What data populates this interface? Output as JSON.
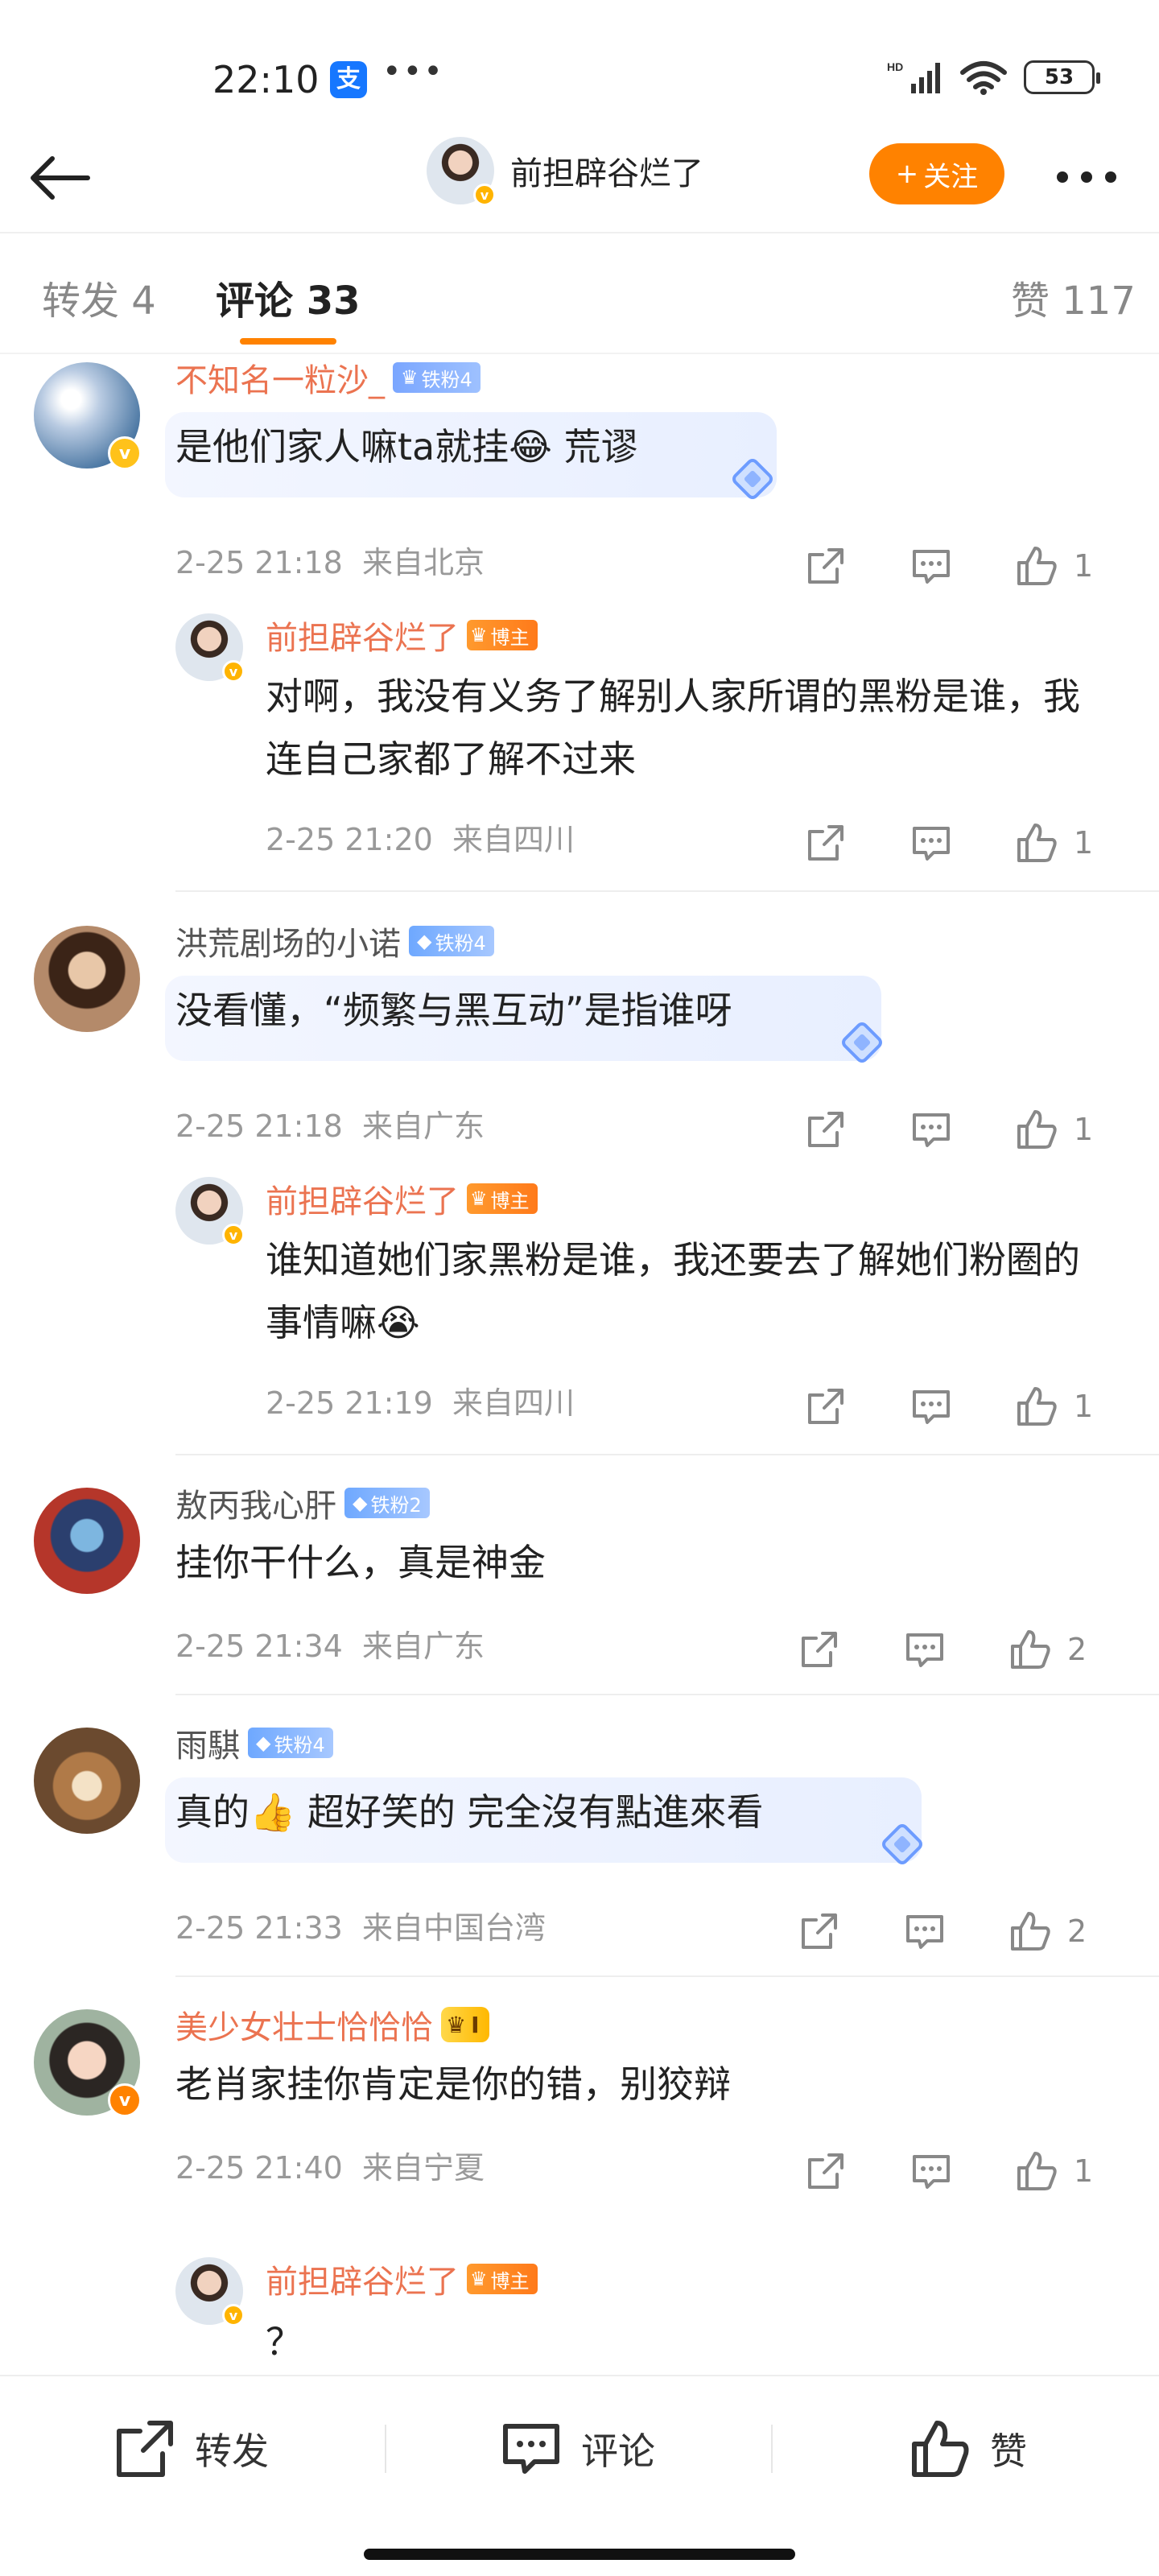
{
  "status_bar": {
    "time": "22:10",
    "alipay_glyph": "支",
    "more": "•••",
    "network": "HD",
    "battery": "53"
  },
  "header": {
    "title": "前担辟谷烂了",
    "follow_label": "关注",
    "follow_plus": "+"
  },
  "tabs": [
    {
      "label": "转发 4"
    },
    {
      "label": "评论 33"
    },
    {
      "label": "赞 117"
    }
  ],
  "comments": [
    {
      "name": "不知名一粒沙_",
      "badge": "铁粉4",
      "text": "是他们家人嘛ta就挂😂 荒谬",
      "time": "2-25 21:18",
      "location": "来自北京",
      "likes": "1",
      "reply": {
        "name": "前担辟谷烂了",
        "badge": "博主",
        "text": "对啊，我没有义务了解别人家所谓的黑粉是谁，我连自己家都了解不过来",
        "time": "2-25 21:20",
        "location": "来自四川",
        "likes": "1"
      }
    },
    {
      "name": "洪荒剧场的小诺",
      "badge": "铁粉4",
      "text": "没看懂，“频繁与黑互动”是指谁呀",
      "time": "2-25 21:18",
      "location": "来自广东",
      "likes": "1",
      "reply": {
        "name": "前担辟谷烂了",
        "badge": "博主",
        "text": "谁知道她们家黑粉是谁，我还要去了解她们粉圈的事情嘛😭",
        "time": "2-25 21:19",
        "location": "来自四川",
        "likes": "1"
      }
    },
    {
      "name": "敖丙我心肝",
      "badge": "铁粉2",
      "text": "挂你干什么，真是神金",
      "time": "2-25 21:34",
      "location": "来自广东",
      "likes": "2"
    },
    {
      "name": "雨騏",
      "badge": "铁粉4",
      "text": "真的👍 超好笑的 完全沒有點進來看",
      "time": "2-25 21:33",
      "location": "来自中国台湾",
      "likes": "2"
    },
    {
      "name": "美少女壮士恰恰恰",
      "badge": "I",
      "text": "老肖家挂你肯定是你的错，别狡辩",
      "time": "2-25 21:40",
      "location": "来自宁夏",
      "likes": "1",
      "reply": {
        "name": "前担辟谷烂了",
        "badge": "博主",
        "text": "？"
      }
    }
  ],
  "bottom_bar": {
    "repost": "转发",
    "comment": "评论",
    "like": "赞"
  },
  "colors": {
    "accent": "#ff8200",
    "name_orange": "#eb7350",
    "meta_gray": "#999999"
  }
}
